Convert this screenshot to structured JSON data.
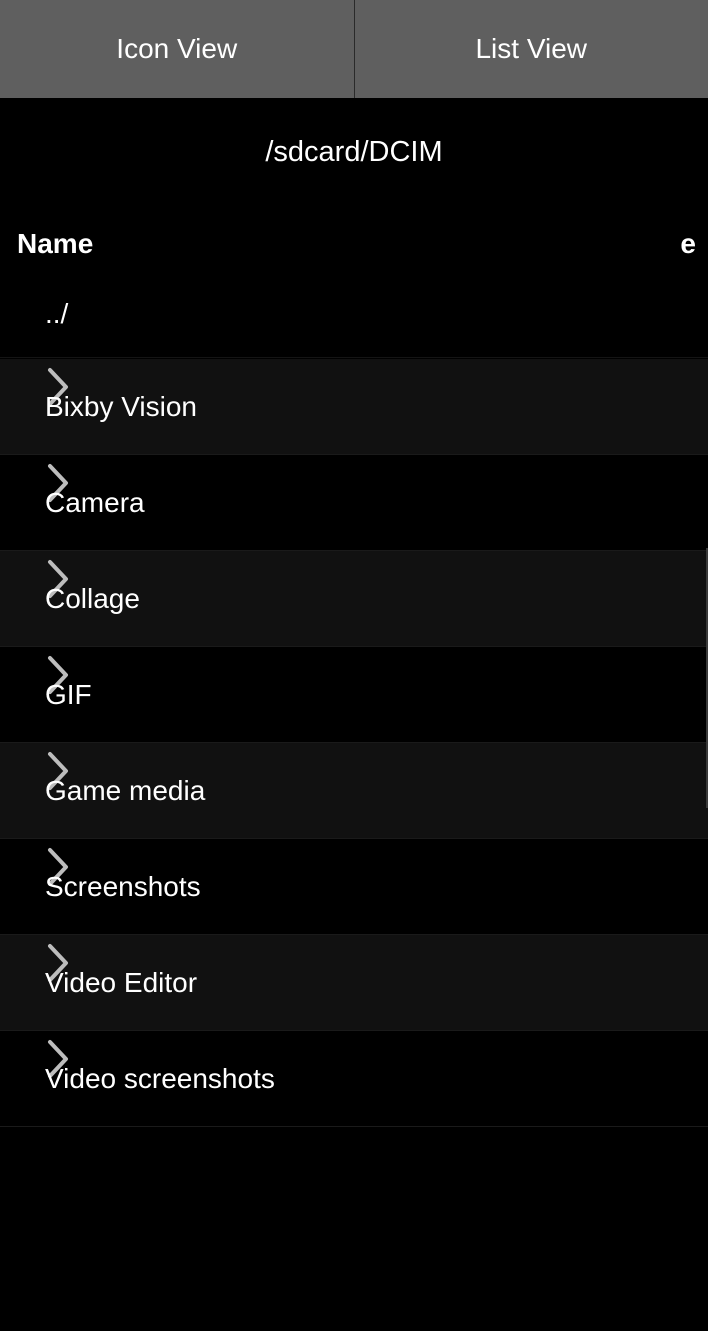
{
  "tabs": [
    {
      "label": "Icon View"
    },
    {
      "label": "List View"
    }
  ],
  "current_path": "/sdcard/DCIM",
  "columns": {
    "name": "Name",
    "size": "e"
  },
  "parent_entry": "../",
  "folders": [
    {
      "name": "Bixby Vision",
      "icon": "chevron-right-icon"
    },
    {
      "name": "Camera",
      "icon": "chevron-right-icon"
    },
    {
      "name": "Collage",
      "icon": "chevron-right-icon"
    },
    {
      "name": "GIF",
      "icon": "chevron-right-icon"
    },
    {
      "name": "Game media",
      "icon": "chevron-right-icon"
    },
    {
      "name": "Screenshots",
      "icon": "chevron-right-icon"
    },
    {
      "name": "Video Editor",
      "icon": "chevron-right-icon"
    },
    {
      "name": "Video screenshots",
      "icon": "chevron-right-icon"
    }
  ],
  "colors": {
    "background": "#000000",
    "tab_bar": "#5f5f5f",
    "row_alt": "#111111",
    "text": "#ffffff",
    "chevron": "#bdbdbd"
  }
}
